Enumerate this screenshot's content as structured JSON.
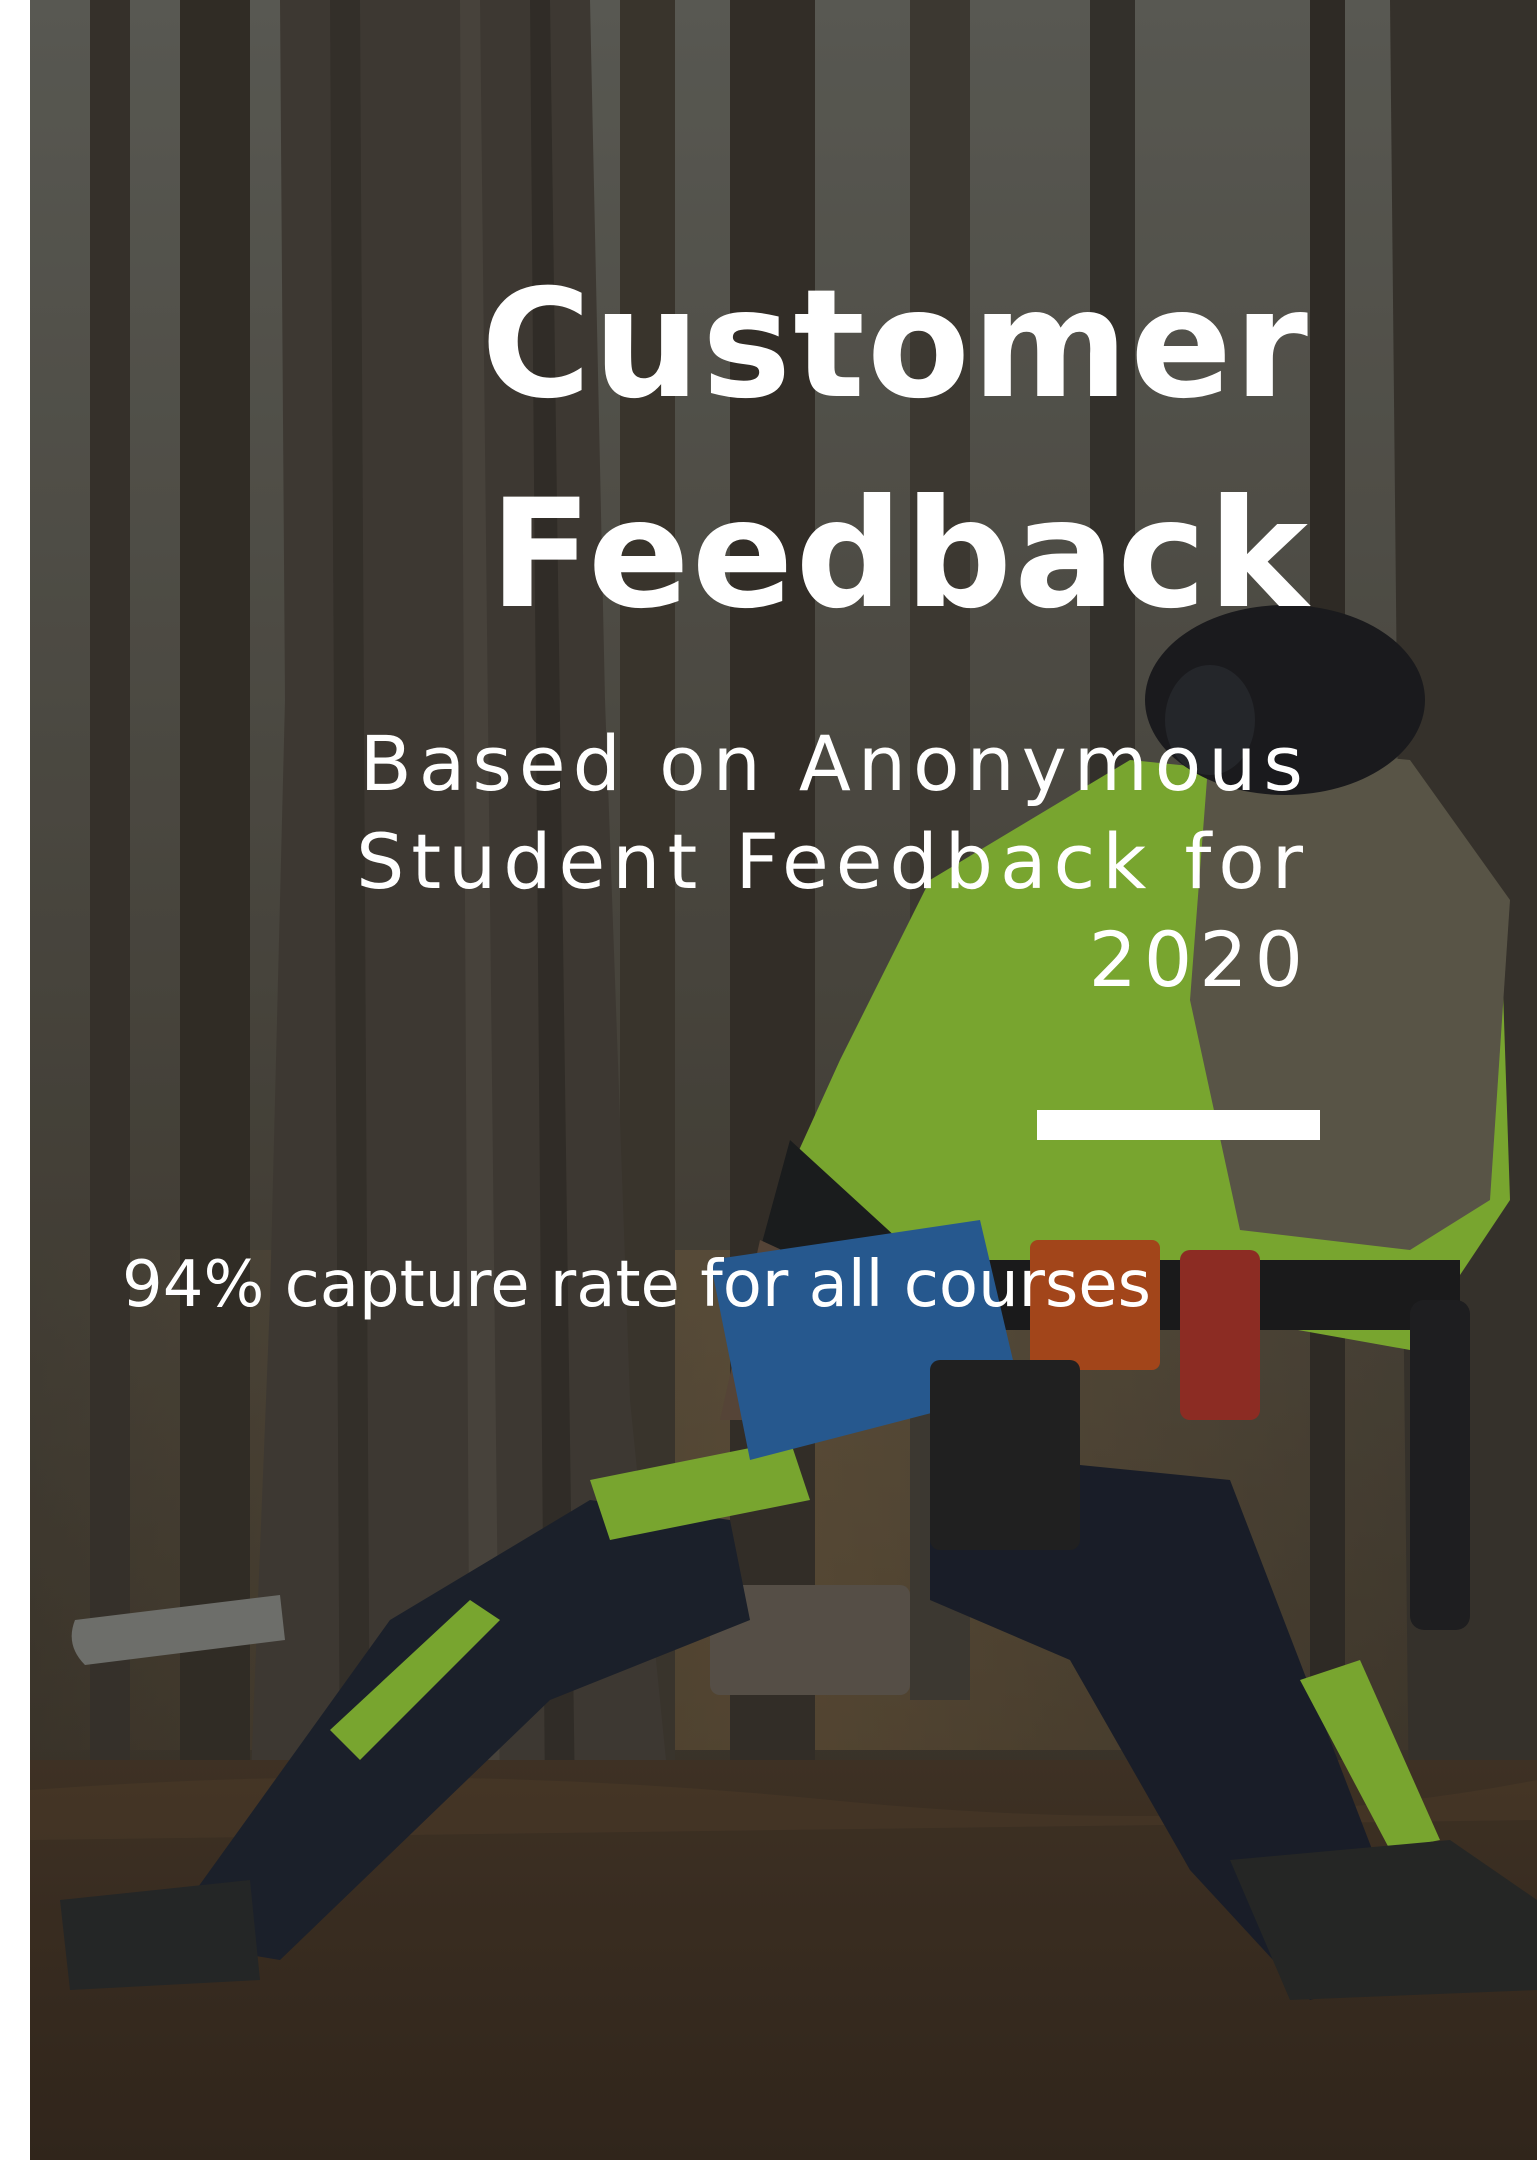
{
  "cover": {
    "title_line1": "Customer",
    "title_line2": "Feedback",
    "subtitle": "Based on Anonymous Student Feedback for 2020",
    "stat_text": "94% capture rate for all courses",
    "background_image": "forestry-worker-in-pine-forest-photo"
  },
  "colors": {
    "text": "#ffffff",
    "hi_vis_green": "#9ad63a",
    "accent_orange": "#d2561e",
    "accent_blue": "#2d6fb8"
  }
}
